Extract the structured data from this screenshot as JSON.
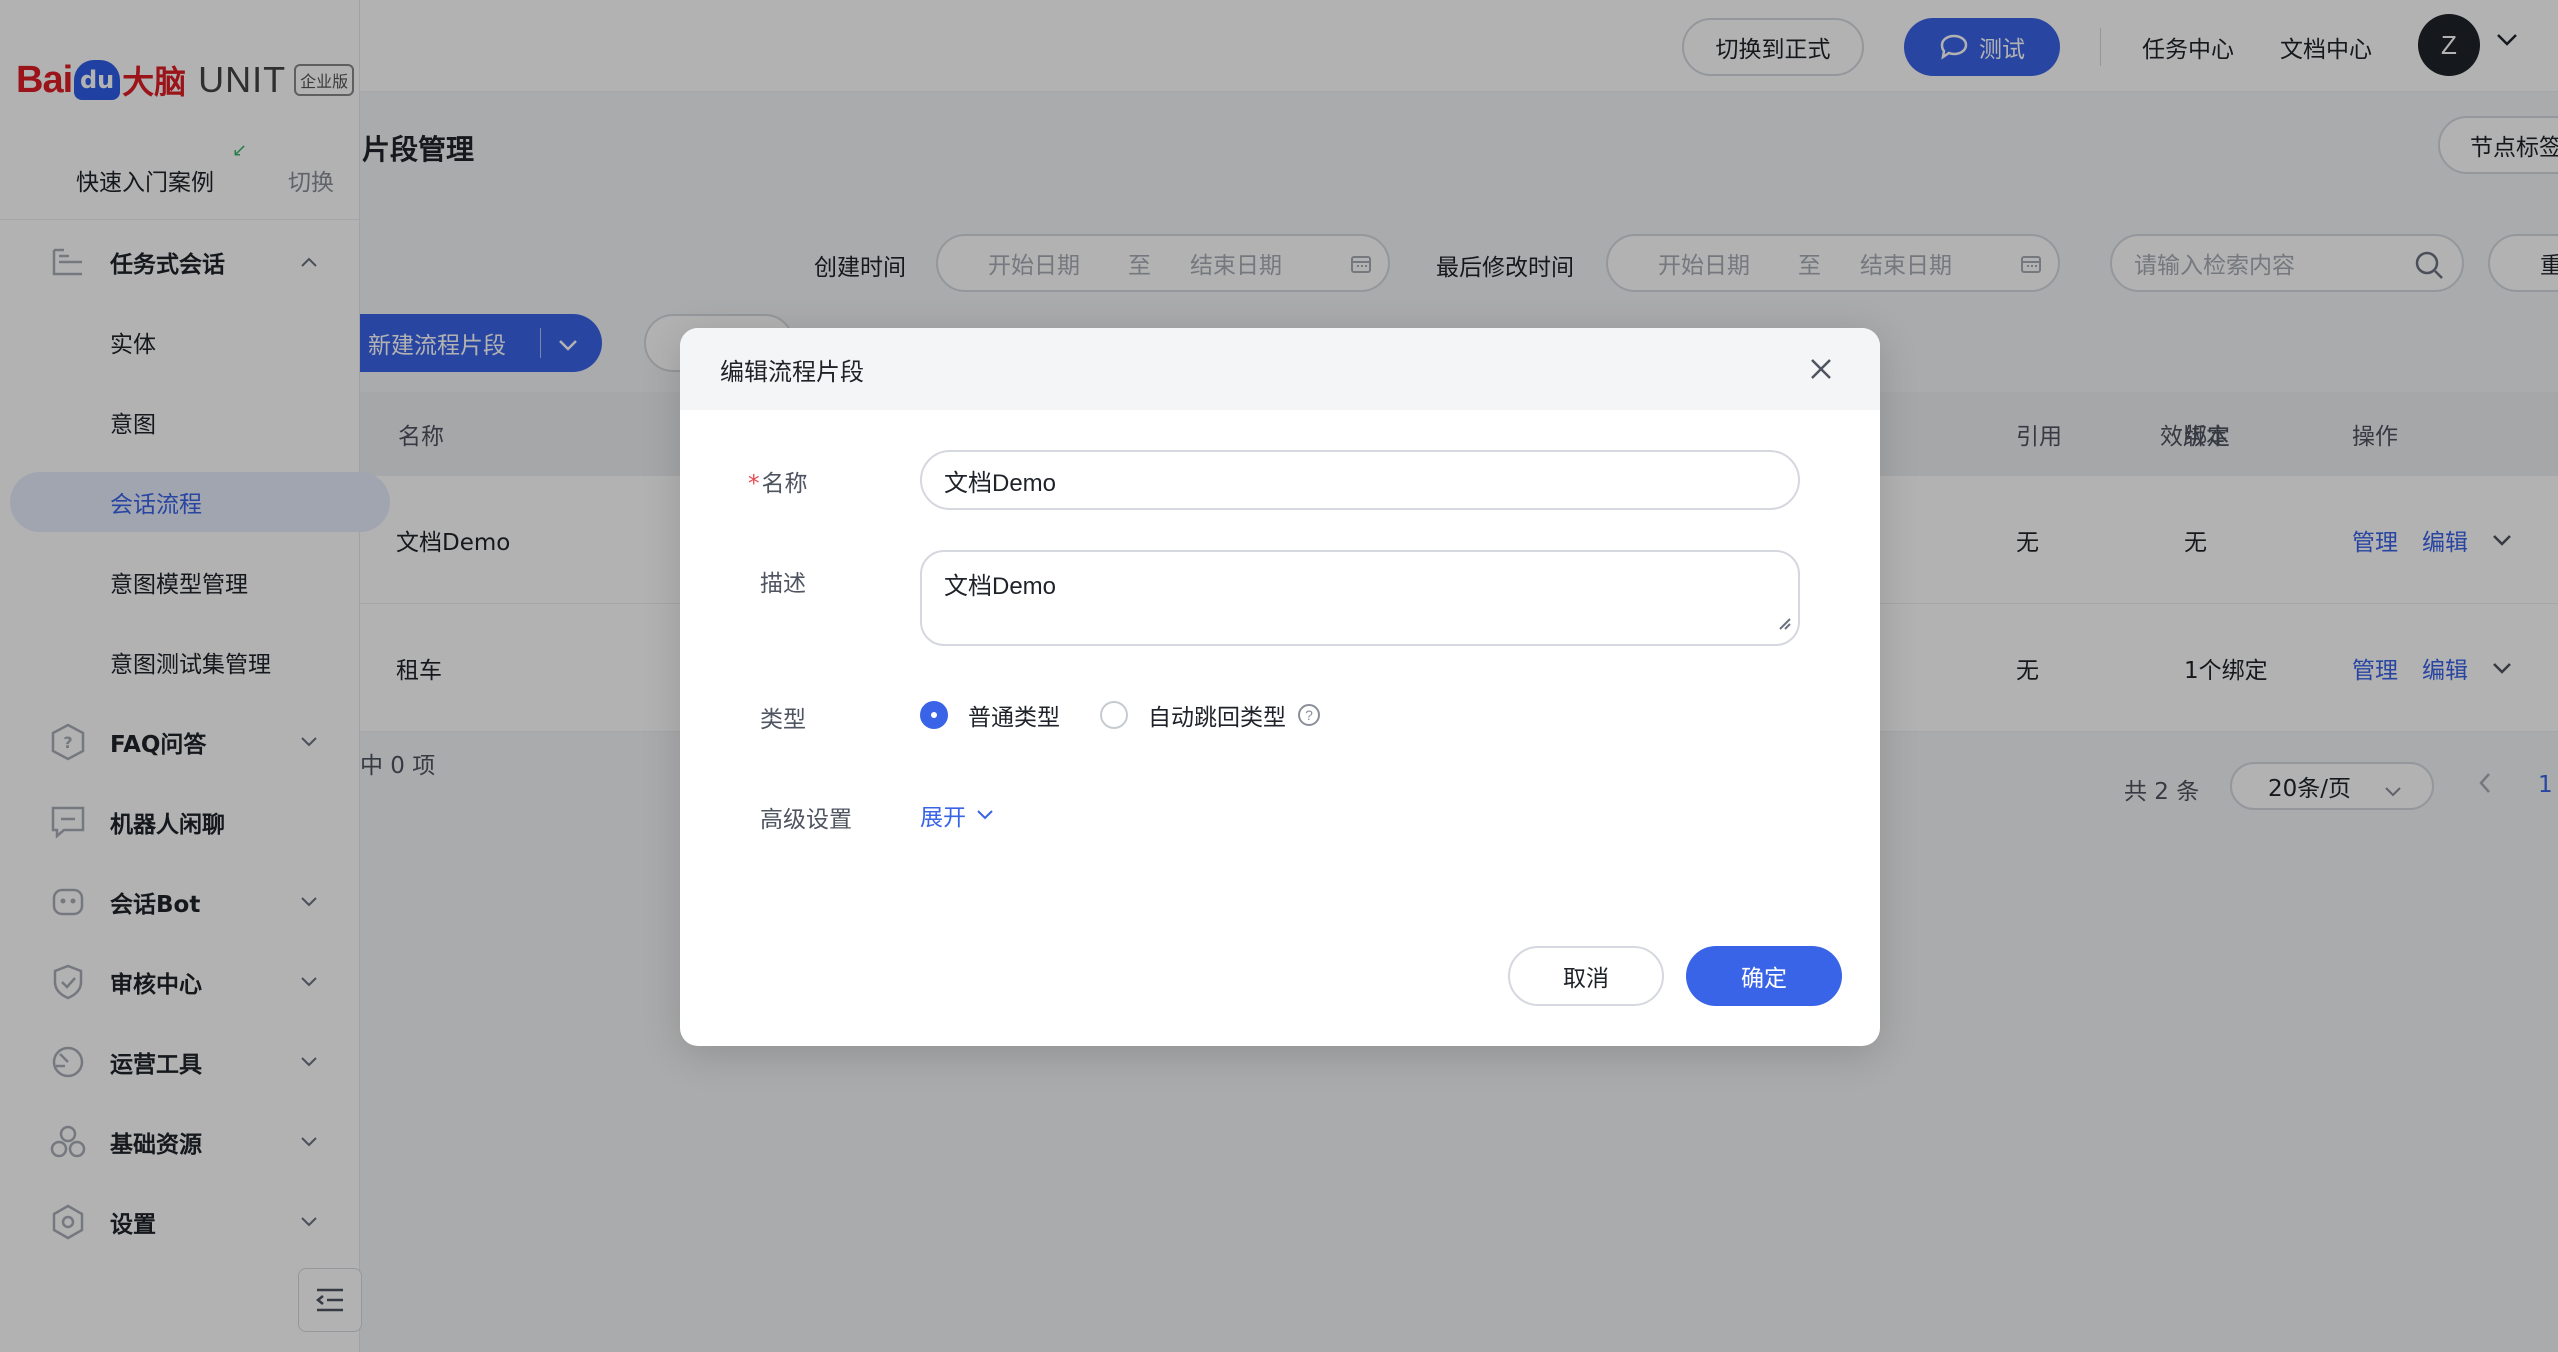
{
  "brand": {
    "logo_baidu": "Bai",
    "logo_paw": "du",
    "logo_danao": "大脑",
    "product": "UNIT",
    "edition": "企业版"
  },
  "sidebar": {
    "quickstart_label": "快速入门案例",
    "quickstart_switch": "切换",
    "items": [
      {
        "label": "任务式会话",
        "type": "group",
        "icon": "task-tree-icon",
        "expanded": true
      },
      {
        "label": "实体",
        "type": "sub"
      },
      {
        "label": "意图",
        "type": "sub"
      },
      {
        "label": "会话流程",
        "type": "sub",
        "active": true
      },
      {
        "label": "意图模型管理",
        "type": "sub"
      },
      {
        "label": "意图测试集管理",
        "type": "sub"
      },
      {
        "label": "FAQ问答",
        "type": "group",
        "icon": "faq-hexagon-icon"
      },
      {
        "label": "机器人闲聊",
        "type": "group",
        "icon": "chat-bubble-icon"
      },
      {
        "label": "会话Bot",
        "type": "group",
        "icon": "robot-icon"
      },
      {
        "label": "审核中心",
        "type": "group",
        "icon": "shield-check-icon"
      },
      {
        "label": "运营工具",
        "type": "group",
        "icon": "gauge-icon"
      },
      {
        "label": "基础资源",
        "type": "group",
        "icon": "cubes-icon"
      },
      {
        "label": "设置",
        "type": "group",
        "icon": "gear-hexagon-icon"
      }
    ]
  },
  "header": {
    "switch_label": "切换到正式",
    "test_label": "测试",
    "task_center": "任务中心",
    "doc_center": "文档中心",
    "avatar_letter": "Z"
  },
  "page": {
    "title": "片段管理",
    "node_tag_button": "节点标签",
    "filters": {
      "created_label": "创建时间",
      "modified_label": "最后修改时间",
      "start_placeholder": "开始日期",
      "range_sep": "至",
      "end_placeholder": "结束日期",
      "search_placeholder": "请输入检索内容",
      "reset_label": "重置"
    },
    "new_button": "新建流程片段",
    "table": {
      "columns": {
        "name": "名称",
        "version": "效版本",
        "ref": "引用",
        "bind": "绑定",
        "ops": "操作"
      },
      "rows": [
        {
          "name": "文档Demo",
          "ref": "无",
          "bind": "无",
          "manage": "管理",
          "edit": "编辑"
        },
        {
          "name": "租车",
          "ref": "无",
          "bind": "1个绑定",
          "manage": "管理",
          "edit": "编辑"
        }
      ]
    },
    "selected_text": "中 0 项",
    "total_text": "共 2 条",
    "page_size": "20条/页",
    "current_page": "1"
  },
  "dialog": {
    "title": "编辑流程片段",
    "name_label": "名称",
    "name_value": "文档Demo",
    "desc_label": "描述",
    "desc_value": "文档Demo",
    "type_label": "类型",
    "type_options": [
      {
        "label": "普通类型",
        "selected": true
      },
      {
        "label": "自动跳回类型",
        "selected": false
      }
    ],
    "advanced_label": "高级设置",
    "expand_label": "展开",
    "cancel_label": "取消",
    "ok_label": "确定"
  },
  "colors": {
    "primary": "#3a64e7",
    "required": "#e5484d",
    "brand_red": "#de1e26"
  }
}
